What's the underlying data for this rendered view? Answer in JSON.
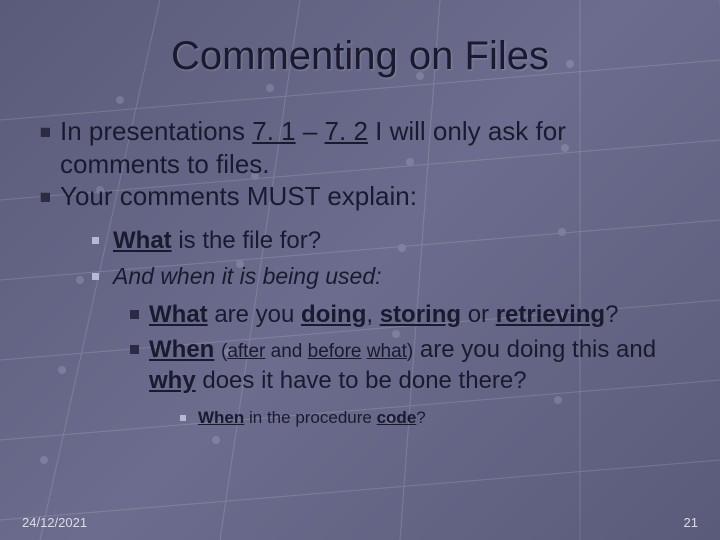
{
  "title": "Commenting on Files",
  "level1": {
    "a_pre": "In presentations ",
    "a_link1": "7. 1",
    "a_mid": " – ",
    "a_link2": "7. 2",
    "a_post": " I will only ask for comments to files.",
    "b": "Your comments MUST explain:"
  },
  "level2": {
    "a_what": "What",
    "a_rest": " is the file for?",
    "b": "And when it is being used:"
  },
  "level3": {
    "a_what": "What",
    "a_mid1": " are you ",
    "a_doing": "doing",
    "a_comma": ", ",
    "a_storing": "storing",
    "a_or": " or ",
    "a_retrieving": "retrieving",
    "a_q": "?",
    "b_when": "When",
    "b_sp1": " ",
    "b_open": "(",
    "b_after": "after",
    "b_and": " and ",
    "b_before": "before",
    "b_sp2": " ",
    "b_what": "what",
    "b_close": ")",
    "b_mid": " are you doing this and ",
    "b_why": "why",
    "b_rest": " does it have to be done there?"
  },
  "level4": {
    "when": "When",
    "mid": " in the procedure ",
    "code": "code",
    "q": "?"
  },
  "footer": {
    "date": "24/12/2021",
    "page": "21"
  }
}
